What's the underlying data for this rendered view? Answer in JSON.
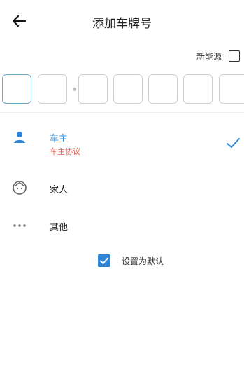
{
  "header": {
    "title": "添加车牌号",
    "back_icon": "arrow-left-icon"
  },
  "new_energy": {
    "label": "新能源",
    "checked": false
  },
  "plate": {
    "cell_count": 7,
    "active_index": 0,
    "values": [
      "",
      "",
      "",
      "",
      "",
      "",
      ""
    ]
  },
  "relations": [
    {
      "label": "车主",
      "icon": "person-icon",
      "selected": true,
      "sub_link": "车主协议"
    },
    {
      "label": "家人",
      "icon": "face-icon",
      "selected": false
    },
    {
      "label": "其他",
      "icon": "more-dots-icon",
      "selected": false
    }
  ],
  "default_option": {
    "label": "设置为默认",
    "checked": true
  },
  "colors": {
    "accent": "#2f86d6",
    "selected_text": "#3b8fd0",
    "link_red": "#e2584a"
  }
}
